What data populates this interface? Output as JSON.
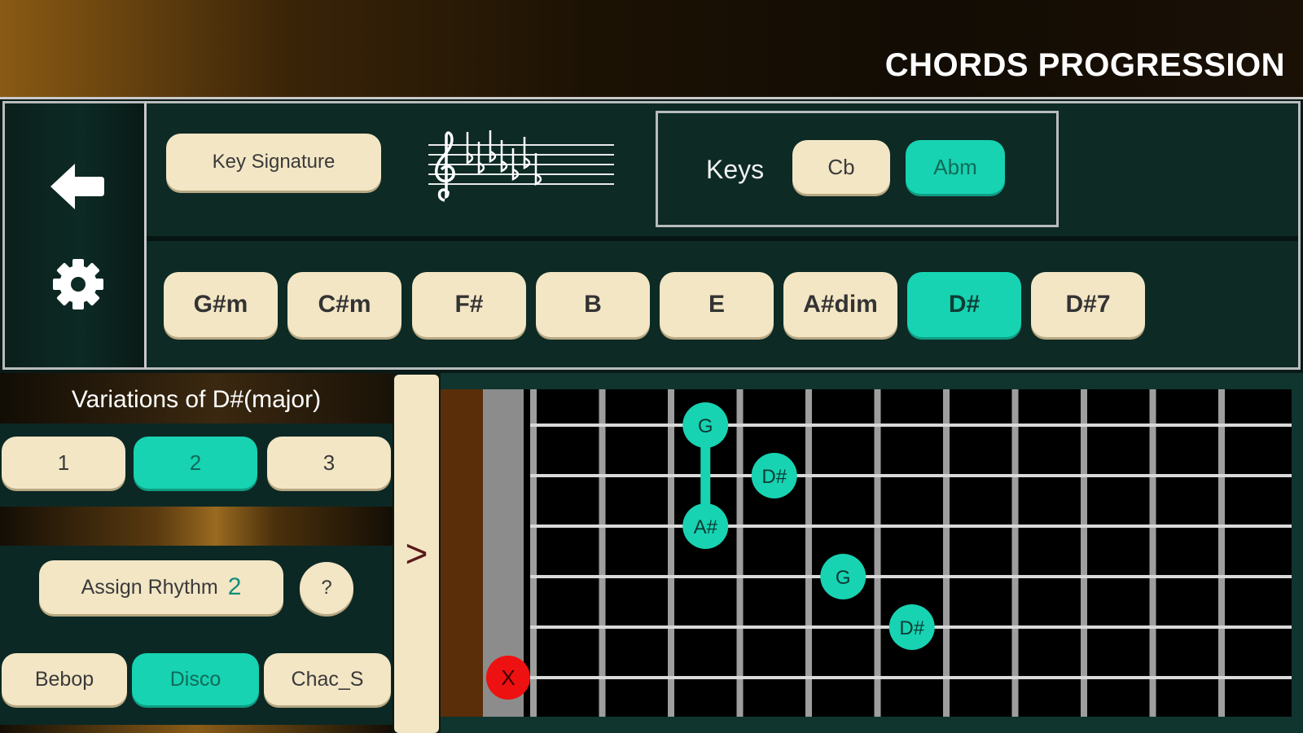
{
  "header": {
    "title": "CHORDS PROGRESSION"
  },
  "sidebar": {
    "back_icon": "back-arrow-icon",
    "settings_icon": "gear-icon"
  },
  "key_signature": {
    "label": "Key Signature",
    "symbol": "treble-clef-7-flats"
  },
  "keys": {
    "label": "Keys",
    "options": [
      "Cb",
      "Abm"
    ],
    "selected": "Abm"
  },
  "chords": {
    "items": [
      "G#m",
      "C#m",
      "F#",
      "B",
      "E",
      "A#dim",
      "D#",
      "D#7"
    ],
    "selected": "D#"
  },
  "variations": {
    "title": "Variations of  D#(major)",
    "items": [
      "1",
      "2",
      "3"
    ],
    "selected": "2"
  },
  "rhythm": {
    "label": "Assign Rhythm",
    "value": "2",
    "help": "?",
    "styles": [
      "Bebop",
      "Disco",
      "Chac_S"
    ],
    "selected": "Disco"
  },
  "expand": {
    "label": ">"
  },
  "fretboard": {
    "strings": 6,
    "frets": 11,
    "notes": [
      {
        "label": "G",
        "string": 1,
        "fret": 3
      },
      {
        "label": "D#",
        "string": 2,
        "fret": 4
      },
      {
        "label": "A#",
        "string": 3,
        "fret": 3
      },
      {
        "label": "G",
        "string": 4,
        "fret": 5
      },
      {
        "label": "D#",
        "string": 5,
        "fret": 6
      }
    ],
    "muted": {
      "label": "X",
      "string": 6
    },
    "colors": {
      "note": "#17d3b2",
      "muted": "#ee1111",
      "string": "#d9d9d9",
      "fret": "#9e9e9e"
    }
  }
}
